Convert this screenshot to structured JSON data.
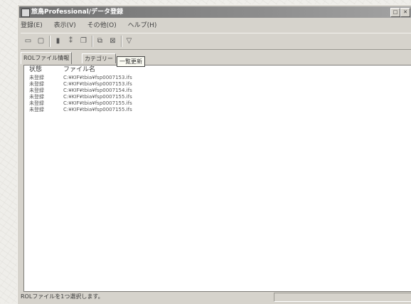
{
  "window": {
    "title": "旅鳥Professional/データ登録"
  },
  "menu": {
    "items": [
      "登録(E)",
      "表示(V)",
      "その他(O)",
      "ヘルプ(H)"
    ]
  },
  "toolbar": {
    "buttons": [
      {
        "icon": "open-folder-icon",
        "glyph": "▭"
      },
      {
        "icon": "new-icon",
        "glyph": "▢"
      },
      {
        "icon": "save-icon",
        "glyph": "▮"
      },
      {
        "icon": "cut-icon",
        "glyph": "⁑"
      },
      {
        "icon": "copy-icon",
        "glyph": "❐"
      },
      {
        "icon": "register-icon",
        "glyph": "⧉"
      },
      {
        "icon": "delete-icon",
        "glyph": "⊠"
      },
      {
        "icon": "filter-icon",
        "glyph": "▽"
      }
    ],
    "tooltip": "一覧更新"
  },
  "tabs": [
    "ROLファイル情報",
    "カテゴリー"
  ],
  "table": {
    "headers": {
      "status": "状態",
      "file": "ファイル名"
    },
    "rows": [
      {
        "status": "未登録",
        "file": "C:¥KIF¥tbia¥fsp0007153.ifs"
      },
      {
        "status": "未登録",
        "file": "C:¥KIF¥tbia¥fsp0007153.ifs"
      },
      {
        "status": "未登録",
        "file": "C:¥KIF¥tbia¥fsp0007154.ifs"
      },
      {
        "status": "未登録",
        "file": "C:¥KIF¥tbia¥fsp0007155.ifs"
      },
      {
        "status": "未登録",
        "file": "C:¥KIF¥tbia¥fsp0007155.ifs"
      },
      {
        "status": "未登録",
        "file": "C:¥KIF¥tbia¥fsp0007155.ifs"
      }
    ]
  },
  "statusbar": {
    "text": "ROLファイルを1つ選択します。"
  }
}
